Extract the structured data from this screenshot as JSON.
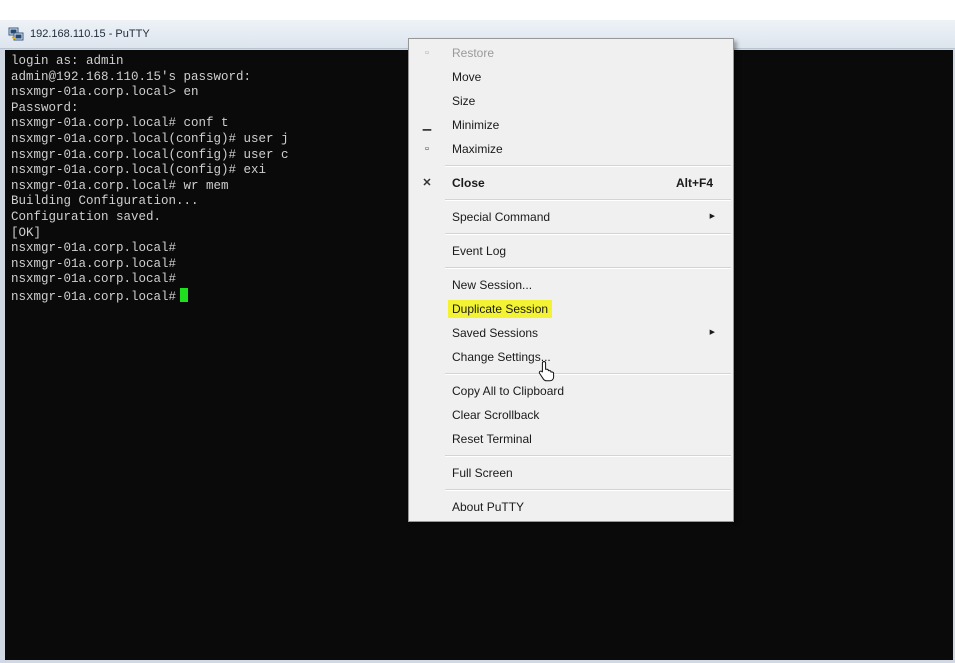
{
  "window": {
    "title": "192.168.110.15 - PuTTY",
    "icon": "putty-icon"
  },
  "terminal": {
    "lines": [
      "login as: admin",
      "admin@192.168.110.15's password:",
      "nsxmgr-01a.corp.local> en",
      "Password:",
      "nsxmgr-01a.corp.local# conf t",
      "nsxmgr-01a.corp.local(config)# user j",
      "nsxmgr-01a.corp.local(config)# user c",
      "nsxmgr-01a.corp.local(config)# exi",
      "nsxmgr-01a.corp.local# wr mem",
      "Building Configuration...",
      "Configuration saved.",
      "[OK]",
      "nsxmgr-01a.corp.local#",
      "nsxmgr-01a.corp.local#",
      "nsxmgr-01a.corp.local#",
      "nsxmgr-01a.corp.local#"
    ],
    "cursor_color": "#1ee01e"
  },
  "context_menu": {
    "items": {
      "restore": "Restore",
      "move": "Move",
      "size": "Size",
      "minimize": "Minimize",
      "maximize": "Maximize",
      "close": "Close",
      "close_shortcut": "Alt+F4",
      "special_command": "Special Command",
      "event_log": "Event Log",
      "new_session": "New Session...",
      "duplicate_session": "Duplicate Session",
      "saved_sessions": "Saved Sessions",
      "change_settings": "Change Settings...",
      "copy_all": "Copy All to Clipboard",
      "clear_scrollback": "Clear Scrollback",
      "reset_terminal": "Reset Terminal",
      "full_screen": "Full Screen",
      "about": "About PuTTY"
    },
    "highlight_color": "#f3f334"
  }
}
